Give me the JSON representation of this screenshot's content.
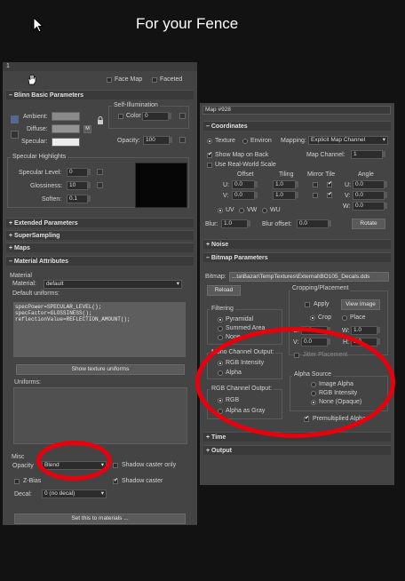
{
  "caption": "For your Fence",
  "left_panel": {
    "corner_num": "1",
    "face_map": "Face Map",
    "faceted": "Faceted",
    "blinn_title": "Blinn Basic Parameters",
    "self_illum_title": "Self-Illumination",
    "color_label": "Color",
    "color_value": "0",
    "ambient": "Ambient:",
    "diffuse": "Diffuse:",
    "specular": "Specular:",
    "m_label": "M",
    "opacity_label": "Opacity:",
    "opacity_value": "100",
    "spec_highlights_title": "Specular Highlights",
    "specular_level": "Specular Level:",
    "specular_level_value": "0",
    "glossiness": "Glossiness:",
    "glossiness_value": "10",
    "soften": "Soften:",
    "soften_value": "0.1",
    "extended": "Extended Parameters",
    "supersampling": "SuperSampling",
    "maps": "Maps",
    "material_attributes": "Material Attributes",
    "material_group": "Material",
    "material_label": "Material:",
    "material_value": "default",
    "default_uniforms": "Default uniforms:",
    "code_lines": [
      "specPower=SPECULAR_LEVEL();",
      "specFactor=GLOSSINESS();",
      "reflectionValue=REFLECTION_AMOUNT();"
    ],
    "show_texture_uniforms": "Show texture uniforms",
    "uniforms": "Uniforms:",
    "misc": "Misc",
    "opacity_row_label": "Opacity",
    "blend_value": "Blend",
    "shadow_caster_only": "Shadow caster only",
    "zbias": "Z-Bias",
    "shadow_caster": "Shadow caster",
    "decal_label": "Decal:",
    "decal_value": "0 (no decal)",
    "set_to_materials": "Set this to materials ..."
  },
  "right_panel": {
    "map_name": "Map #928",
    "coordinates": "Coordinates",
    "texture": "Texture",
    "environ": "Environ",
    "mapping_label": "Mapping:",
    "mapping_value": "Explicit Map Channel",
    "show_map_on_back": "Show Map on Back",
    "map_channel_label": "Map Channel:",
    "map_channel_value": "1",
    "use_real_world_scale": "Use Real-World Scale",
    "col_offset": "Offset",
    "col_tiling": "Tiling",
    "col_mirror_tile": "Mirror Tile",
    "col_angle": "Angle",
    "u_label": "U:",
    "v_label": "V:",
    "w_label": "W:",
    "u_offset": "0.0",
    "v_offset": "0.0",
    "u_tiling": "1.0",
    "v_tiling": "1.0",
    "u_angle": "0.0",
    "v_angle": "0.0",
    "w_angle": "0.0",
    "uv": "UV",
    "vw": "VW",
    "wu": "WU",
    "blur_label": "Blur:",
    "blur_value": "1.0",
    "blur_offset_label": "Blur offset:",
    "blur_offset_value": "0.0",
    "rotate": "Rotate",
    "noise": "Noise",
    "bitmap_params": "Bitmap Parameters",
    "bitmap_label": "Bitmap:",
    "bitmap_path": "...ta\\Bazar\\TempTextures\\External\\BO105_Decals.dds",
    "reload": "Reload",
    "cropping_placement": "Cropping/Placement",
    "apply": "Apply",
    "view_image": "View Image",
    "crop": "Crop",
    "place": "Place",
    "u_crop": "0.0",
    "v_crop": "0.0",
    "w_crop": "1.0",
    "h_crop": "1.0",
    "h_label": "H:",
    "jitter_placement": "Jitter Placement",
    "jitter_value": "1.0",
    "filtering": "Filtering",
    "pyramidal": "Pyramidal",
    "summed_area": "Summed Area",
    "none": "None",
    "mono_channel_output": "Mono Channel Output:",
    "rgb_intensity": "RGB Intensity",
    "alpha": "Alpha",
    "alpha_source": "Alpha Source",
    "image_alpha": "Image Alpha",
    "rgb_intensity_2": "RGB Intensity",
    "none_opaque": "None (Opaque)",
    "rgb_channel_output": "RGB Channel Output:",
    "rgb": "RGB",
    "alpha_as_gray": "Alpha as Gray",
    "premultiplied_alpha": "Premultiplied Alpha",
    "time": "Time",
    "output": "Output"
  },
  "colors": {
    "annotation_red": "#e8000d",
    "panel_bg": "#444444",
    "header_bg": "#3a3a3a"
  }
}
